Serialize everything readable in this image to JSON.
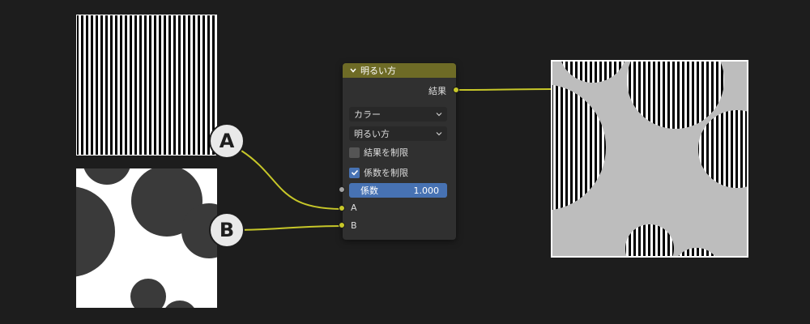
{
  "node": {
    "title": "明るい方",
    "output_label": "結果",
    "blend_type": "カラー",
    "operation": "明るい方",
    "clamp_result": {
      "label": "結果を制限",
      "checked": false
    },
    "clamp_factor": {
      "label": "係数を制限",
      "checked": true
    },
    "factor": {
      "label": "係数",
      "value": "1.000"
    },
    "input_a_label": "A",
    "input_b_label": "B"
  },
  "badges": {
    "a": "A",
    "b": "B"
  },
  "colors": {
    "background": "#1d1d1d",
    "node_body": "#303030",
    "node_header": "#6e6b26",
    "color_socket": "#c7c729",
    "float_socket": "#a1a1a1",
    "accent": "#4772b3",
    "link": "#c7c729"
  },
  "images": {
    "input_a": "vertical black-white stripes",
    "input_b": "dark grey circles on white",
    "result": "striped circles on light grey"
  }
}
